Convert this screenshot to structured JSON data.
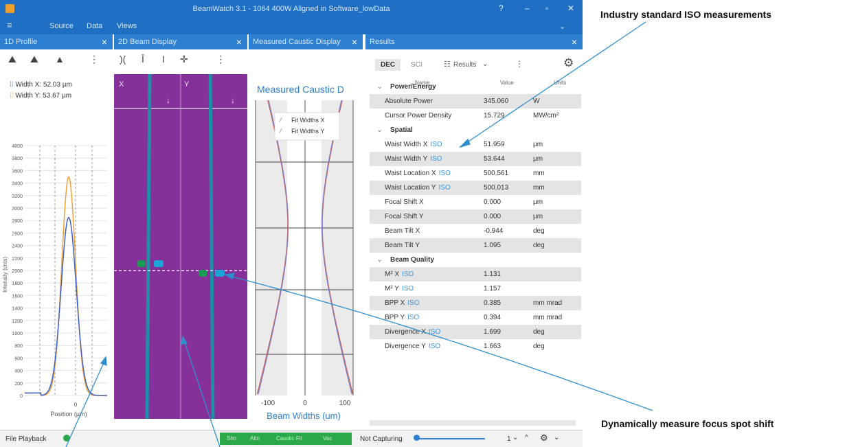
{
  "window": {
    "title": "BeamWatch 3.1 - 1064 400W Aligned in Software_lowData"
  },
  "menu": {
    "items": [
      "Source",
      "Data",
      "Views"
    ]
  },
  "panels": {
    "profile1d": {
      "title": "1D Profile",
      "width_x": "Width X: 52.03 µm",
      "width_y": "Width Y: 53.67 µm",
      "y_ticks": [
        "4000",
        "3800",
        "3600",
        "3400",
        "3200",
        "3000",
        "2800",
        "2600",
        "2400",
        "2200",
        "2000",
        "1800",
        "1600",
        "1400",
        "1200",
        "1000",
        "800",
        "600",
        "400",
        "200",
        "0"
      ],
      "y_label": "Intensity (cnts)",
      "x_label": "Position (µm)",
      "x_tick": "0"
    },
    "beam2d": {
      "title": "2D Beam Display",
      "label_x": "X",
      "label_y": "Y"
    },
    "caustic": {
      "title": "Measured Caustic Display",
      "heading": "Measured Caustic D",
      "legend": [
        "Fit Widths X",
        "Fit Widths Y"
      ],
      "x_ticks": [
        "-100",
        "0",
        "100"
      ],
      "x_label": "Beam Widths (um)"
    },
    "results": {
      "title": "Results",
      "tabs": [
        "DEC",
        "SCI"
      ],
      "results_dropdown": "Results",
      "col_headers": [
        "Name",
        "Value",
        "Units"
      ],
      "rows": [
        {
          "type": "section",
          "name": "Power/Energy"
        },
        {
          "name": "Absolute Power",
          "value": "345.060",
          "unit": "W"
        },
        {
          "name": "Cursor Power Density",
          "value": "15.729",
          "unit": "MW/cm²"
        },
        {
          "type": "section",
          "name": "Spatial"
        },
        {
          "name": "Waist Width X",
          "iso": "ISO",
          "value": "51.959",
          "unit": "µm"
        },
        {
          "name": "Waist Width Y",
          "iso": "ISO",
          "value": "53.644",
          "unit": "µm"
        },
        {
          "name": "Waist Location X",
          "iso": "ISO",
          "value": "500.561",
          "unit": "mm"
        },
        {
          "name": "Waist Location Y",
          "iso": "ISO",
          "value": "500.013",
          "unit": "mm"
        },
        {
          "name": "Focal Shift X",
          "value": "0.000",
          "unit": "µm"
        },
        {
          "name": "Focal Shift Y",
          "value": "0.000",
          "unit": "µm"
        },
        {
          "name": "Beam Tilt X",
          "value": "-0.944",
          "unit": "deg"
        },
        {
          "name": "Beam Tilt Y",
          "value": "1.095",
          "unit": "deg"
        },
        {
          "type": "section",
          "name": "Beam Quality"
        },
        {
          "name": "M² X",
          "iso": "ISO",
          "value": "1.131",
          "unit": ""
        },
        {
          "name": "M² Y",
          "iso": "ISO",
          "value": "1.157",
          "unit": ""
        },
        {
          "name": "BPP X",
          "iso": "ISO",
          "value": "0.385",
          "unit": "mm mrad"
        },
        {
          "name": "BPP Y",
          "iso": "ISO",
          "value": "0.394",
          "unit": "mm mrad"
        },
        {
          "name": "Divergence X",
          "iso": "ISO",
          "value": "1.699",
          "unit": "deg"
        },
        {
          "name": "Divergence Y",
          "iso": "ISO",
          "value": "1.663",
          "unit": "deg"
        }
      ]
    }
  },
  "status": {
    "left": "File Playback",
    "badges": [
      "Shtr",
      "Attn",
      "Caustic Fit",
      "Vac"
    ],
    "capture": "Not Capturing",
    "count": "1"
  },
  "annotations": {
    "top": "Industry standard ISO measurements",
    "bottom": "Dynamically measure focus spot shift"
  },
  "colors": {
    "titlebar": "#1f6fc4",
    "panel_title": "#2d7fd2",
    "beam_bg": "#86309a",
    "accent": "#3b95e0",
    "orange": "#f2a13a",
    "blue_line": "#3d63c8",
    "green": "#1a9a52"
  }
}
